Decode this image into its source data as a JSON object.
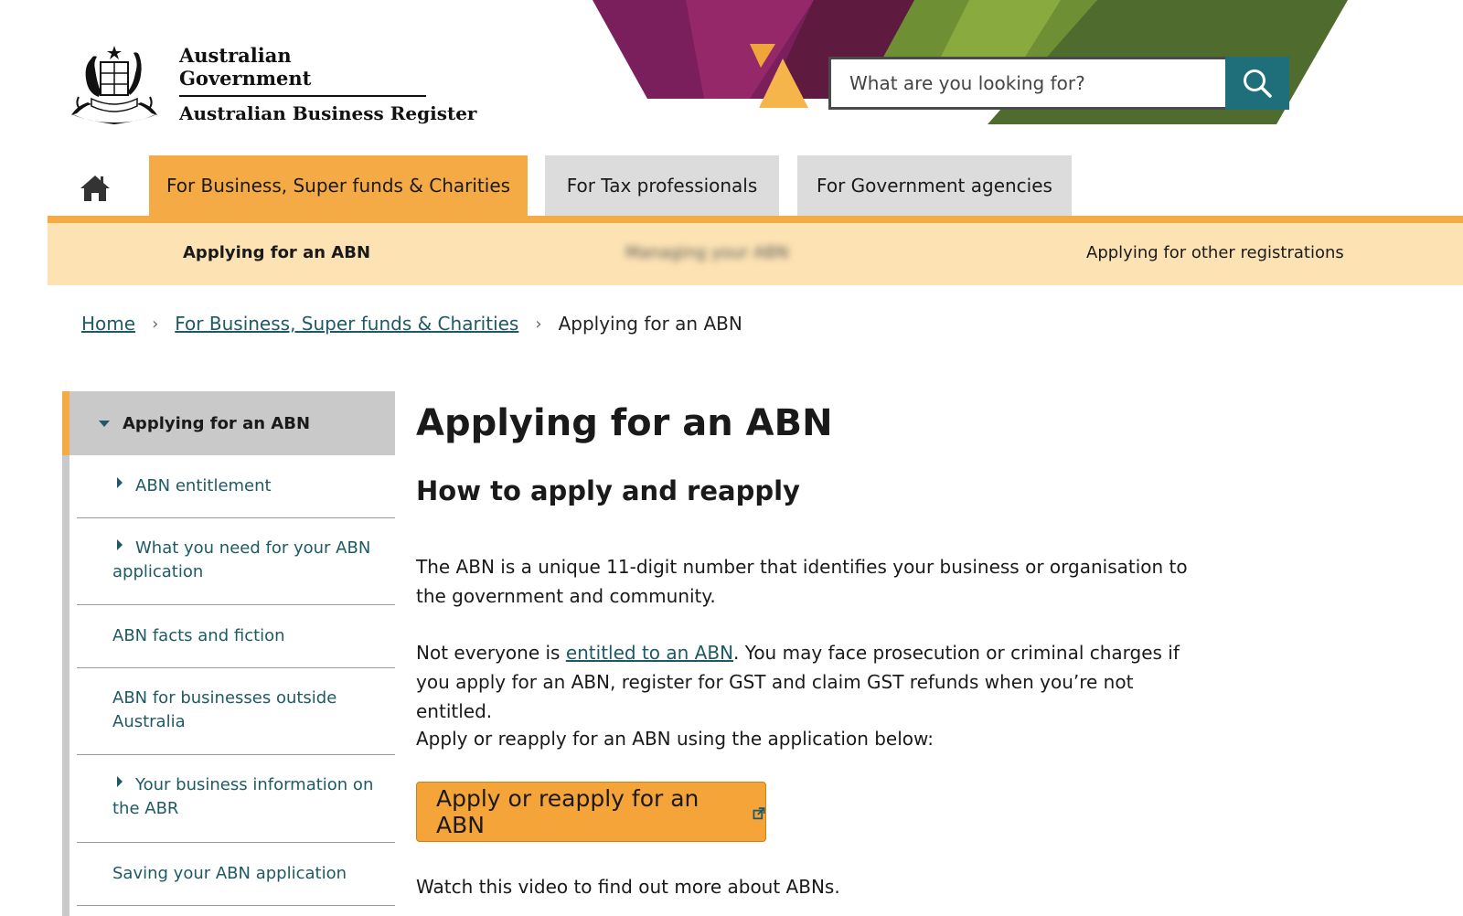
{
  "header": {
    "gov_name": "Australian Government",
    "org_name": "Australian Business Register",
    "search_placeholder": "What are you looking for?"
  },
  "main_nav": {
    "tabs": [
      {
        "label": "For Business, Super funds & Charities",
        "active": true
      },
      {
        "label": "For Tax professionals",
        "active": false
      },
      {
        "label": "For Government agencies",
        "active": false
      }
    ]
  },
  "sub_nav": {
    "items": [
      {
        "label": "Applying for an ABN"
      },
      {
        "label": "Managing your ABN"
      },
      {
        "label": "Applying for other registrations"
      }
    ]
  },
  "breadcrumb": {
    "home": "Home",
    "section": "For Business, Super funds & Charities",
    "current": "Applying for an ABN"
  },
  "sidebar": {
    "heading": "Applying for an ABN",
    "items": [
      {
        "label": "ABN entitlement",
        "expandable": true
      },
      {
        "label": "What you need for your ABN application",
        "expandable": true
      },
      {
        "label": "ABN facts and fiction",
        "expandable": false
      },
      {
        "label": "ABN for businesses outside Australia",
        "expandable": false
      },
      {
        "label": "Your business information on the ABR",
        "expandable": true
      },
      {
        "label": "Saving your ABN application",
        "expandable": false
      }
    ]
  },
  "content": {
    "title": "Applying for an ABN",
    "subtitle": "How to apply and reapply",
    "para1": "The ABN is a unique 11-digit number that identifies your business or organisation to the government and community.",
    "para2_before": "Not everyone is ",
    "para2_link": "entitled to an ABN",
    "para2_after": ". You may face prosecution or criminal charges if you apply for an ABN, register for GST and claim GST refunds when you’re not entitled.",
    "para3": "Apply or reapply for an ABN using the application below:",
    "apply_button": "Apply or reapply for an ABN",
    "para4": "Watch this video to find out more about ABNs."
  },
  "colors": {
    "accent_orange": "#f5ab45",
    "subnav_bg": "#fde3b4",
    "teal": "#1e6f79",
    "link": "#1e5a65",
    "tab_inactive": "#dcdcdc"
  }
}
